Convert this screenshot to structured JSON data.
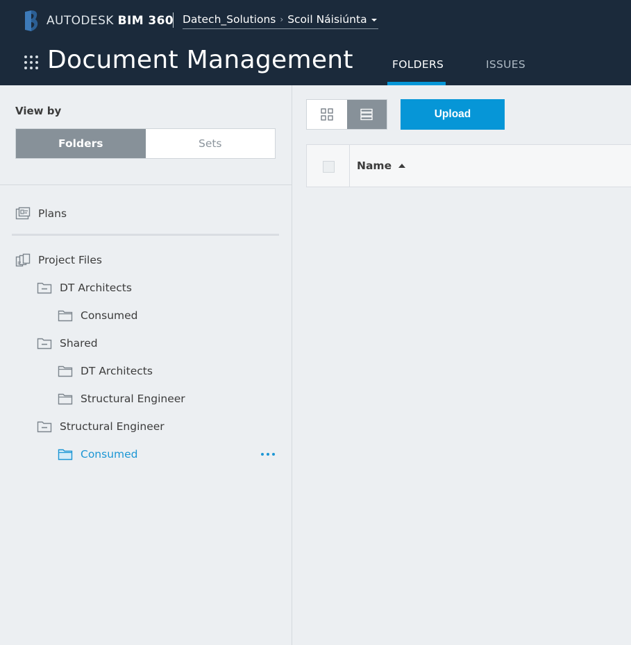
{
  "header": {
    "brand_company": "AUTODESK",
    "brand_product": "BIM 360",
    "breadcrumb": {
      "account": "Datech_Solutions",
      "project": "Scoil Náisiúnta"
    },
    "module_title": "Document Management",
    "tabs": [
      {
        "label": "FOLDERS",
        "active": true
      },
      {
        "label": "ISSUES",
        "active": false
      }
    ]
  },
  "sidebar": {
    "view_by_label": "View by",
    "view_by_options": [
      {
        "label": "Folders",
        "selected": true
      },
      {
        "label": "Sets",
        "selected": false
      }
    ],
    "tree": [
      {
        "label": "Plans",
        "icon": "plans-icon",
        "level": 0
      },
      {
        "label": "Project Files",
        "icon": "project-files-icon",
        "level": 0
      },
      {
        "label": "DT Architects",
        "icon": "folder-collapse-icon",
        "level": 1
      },
      {
        "label": "Consumed",
        "icon": "folder-icon",
        "level": 2
      },
      {
        "label": "Shared",
        "icon": "folder-collapse-icon",
        "level": 1
      },
      {
        "label": "DT Architects",
        "icon": "folder-icon",
        "level": 2
      },
      {
        "label": "Structural Engineer",
        "icon": "folder-icon",
        "level": 2
      },
      {
        "label": "Structural Engineer",
        "icon": "folder-collapse-icon",
        "level": 1
      },
      {
        "label": "Consumed",
        "icon": "folder-icon",
        "level": 2,
        "selected": true
      }
    ]
  },
  "main": {
    "view_modes": [
      {
        "name": "grid-view-icon",
        "active": false
      },
      {
        "name": "list-view-icon",
        "active": true
      }
    ],
    "upload_label": "Upload",
    "table": {
      "columns": [
        {
          "label": "Name",
          "sort": "ascending"
        }
      ]
    }
  },
  "colors": {
    "header_bg": "#1b2a3b",
    "accent": "#0696d7",
    "selected_text": "#1c96d4",
    "segment_on": "#879199",
    "panel_bg": "#eceff2"
  }
}
